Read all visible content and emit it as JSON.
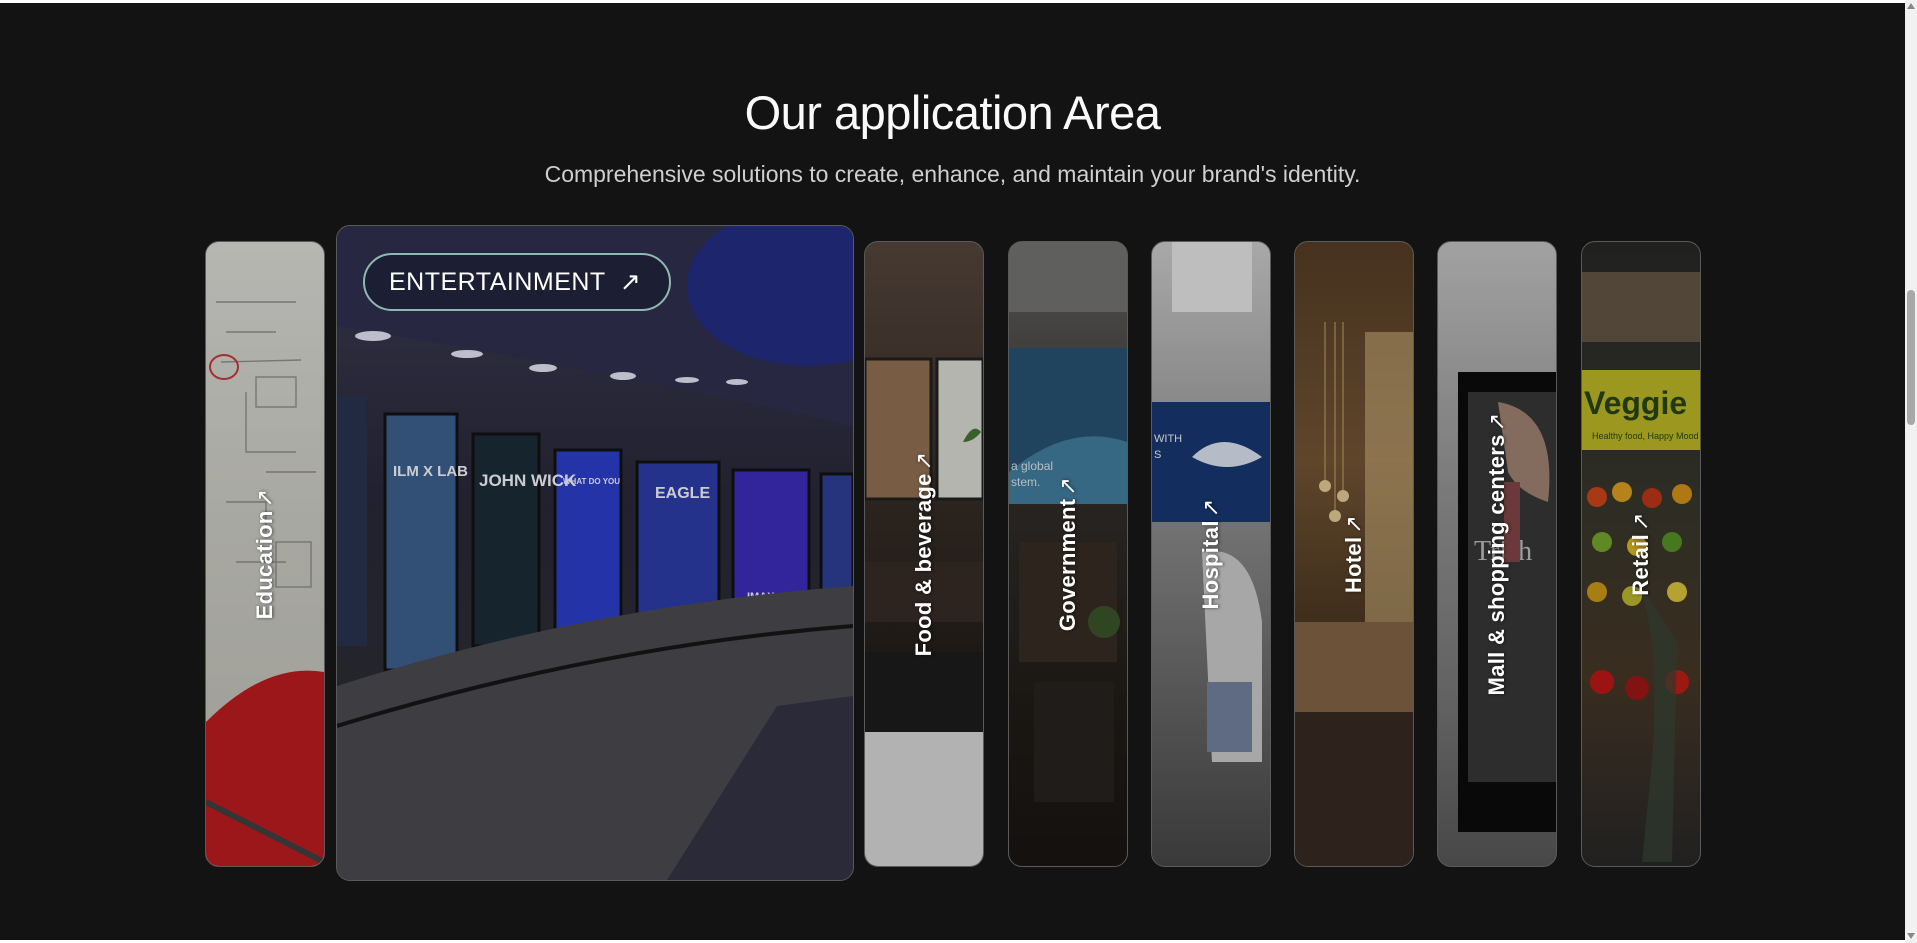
{
  "section": {
    "title": "Our application Area",
    "subtitle": "Comprehensive solutions to create, enhance, and maintain your brand's identity."
  },
  "active_card": {
    "label": "ENTERTAINMENT",
    "arrow": "↗"
  },
  "cards": [
    {
      "label": "Education",
      "arrow": "↗"
    },
    {
      "label": "Food & beverage",
      "arrow": "↗"
    },
    {
      "label": "Government",
      "arrow": "↗"
    },
    {
      "label": "Hospital",
      "arrow": "↗"
    },
    {
      "label": "Hotel",
      "arrow": "↗"
    },
    {
      "label": "Mall & shopping centers",
      "arrow": "↗"
    },
    {
      "label": "Retail",
      "arrow": "↗"
    }
  ],
  "entertainment_posters": [
    {
      "text": "ILM X LAB"
    },
    {
      "text": "JOHN WICK"
    },
    {
      "text": "WHAT DO YOU WANT TO BE WHEN YOU SHOW UP?"
    },
    {
      "text": "EAGLE"
    },
    {
      "text": "IMAX"
    }
  ],
  "scene_text": {
    "government": "a global stem.",
    "hospital": "WITH S",
    "mall_brand": "Trish",
    "retail_sign": "Veggie",
    "retail_tagline": "Healthy food, Happy Mood"
  },
  "colors": {
    "page_bg": "#131313",
    "title": "#fafafa",
    "subtitle": "#cfcfcf",
    "pill_border": "#8fb9b0"
  }
}
